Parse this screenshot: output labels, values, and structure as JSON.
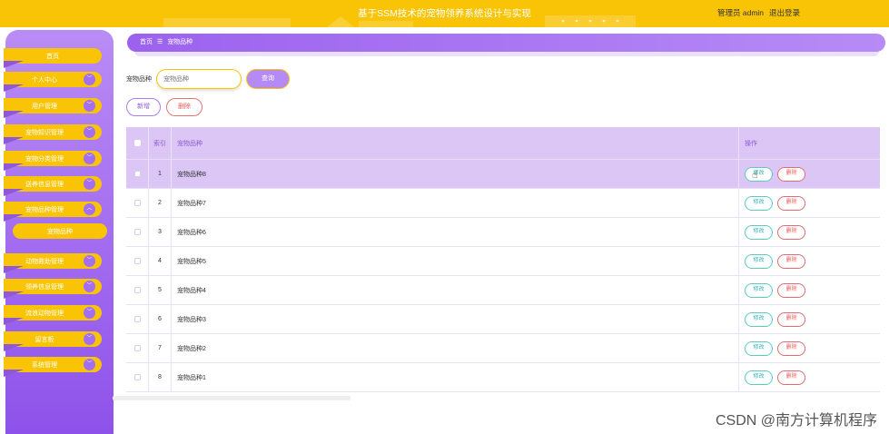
{
  "header": {
    "title": "基于SSM技术的宠物领养系统设计与实现",
    "user_label": "管理员 admin",
    "logout": "退出登录"
  },
  "sidebar": {
    "items": [
      {
        "label": "首页",
        "has_chevron": false
      },
      {
        "label": "个人中心",
        "has_chevron": true
      },
      {
        "label": "用户管理",
        "has_chevron": true
      },
      {
        "label": "宠物知识管理",
        "has_chevron": true
      },
      {
        "label": "宠物分类管理",
        "has_chevron": true
      },
      {
        "label": "送养信息管理",
        "has_chevron": true
      },
      {
        "label": "宠物品种管理",
        "has_chevron": true,
        "expanded": true
      },
      {
        "label": "宠物品种",
        "sub": true
      },
      {
        "label": "动物救助管理",
        "has_chevron": true
      },
      {
        "label": "领养信息管理",
        "has_chevron": true
      },
      {
        "label": "流浪动物管理",
        "has_chevron": true
      },
      {
        "label": "留言板",
        "has_chevron": true
      },
      {
        "label": "系统管理",
        "has_chevron": true
      }
    ]
  },
  "breadcrumb": {
    "home": "首页",
    "separator": "☰",
    "current": "宠物品种"
  },
  "search": {
    "label": "宠物品种",
    "placeholder": "宠物品种",
    "button": "查询"
  },
  "actions": {
    "add": "新增",
    "delete": "删除"
  },
  "table": {
    "headers": {
      "index": "索引",
      "name": "宠物品种",
      "ops": "操作"
    },
    "edit_label": "修改",
    "delete_label": "删除",
    "rows": [
      {
        "index": "1",
        "name": "宠物品种8",
        "selected": true
      },
      {
        "index": "2",
        "name": "宠物品种7"
      },
      {
        "index": "3",
        "name": "宠物品种6"
      },
      {
        "index": "4",
        "name": "宠物品种5"
      },
      {
        "index": "5",
        "name": "宠物品种4"
      },
      {
        "index": "6",
        "name": "宠物品种3"
      },
      {
        "index": "7",
        "name": "宠物品种2"
      },
      {
        "index": "8",
        "name": "宠物品种1"
      }
    ]
  },
  "watermark": "CSDN @南方计算机程序",
  "colors": {
    "accent_yellow": "#f9c405",
    "accent_purple": "#a46ef0",
    "header_row": "#dcc6f6",
    "edit_teal": "#5cc8c8",
    "delete_red": "#e36c6c"
  }
}
